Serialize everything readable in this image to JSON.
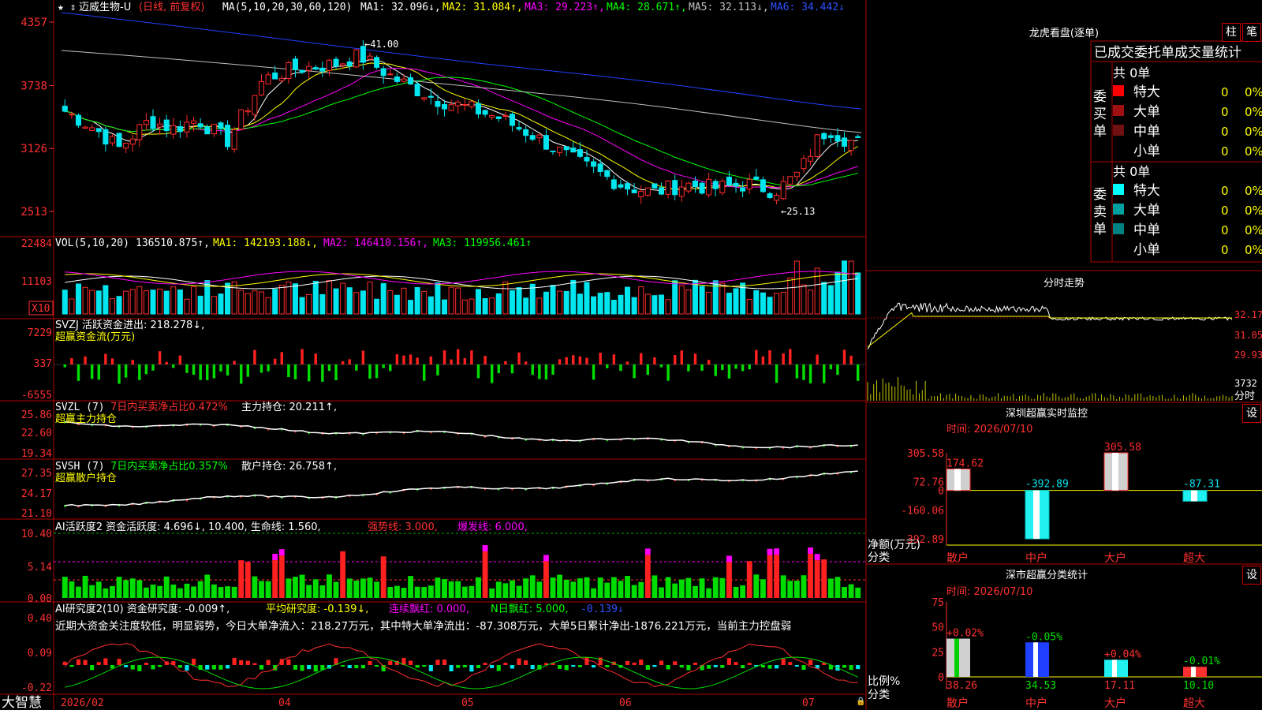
{
  "app": {
    "brand": "大智慧",
    "brand_color": "#ffffff"
  },
  "colors": {
    "up": "#ff2a2a",
    "down": "#00e5ee",
    "grid": "#a00000",
    "pos_bar": "#ff2020",
    "neg_bar": "#00dd00",
    "ma1": "#ffffff",
    "ma2": "#ffff00",
    "ma3": "#ff00ff",
    "ma4": "#00ff00",
    "ma5": "#c0c0c0",
    "ma6": "#2040ff"
  },
  "header": {
    "icons": "★ ⇕",
    "stock": "迈威生物-U",
    "mode": "(日线, 前复权)",
    "ma_def": "MA(5,10,20,30,60,120)",
    "ma1": "MA1: 32.096↓,",
    "ma2": "MA2: 31.084↑,",
    "ma3": "MA3: 29.223↑,",
    "ma4": "MA4: 28.671↑,",
    "ma5": "MA5: 32.113↓,",
    "ma6": "MA6: 34.442↓"
  },
  "price_axis": [
    "4357",
    "3738",
    "3126",
    "2513"
  ],
  "annotations": {
    "high": "←41.00",
    "low": "←25.13"
  },
  "vol": {
    "def": "VOL(5,10,20)",
    "value": "136510.875↑,",
    "ma1": "MA1: 142193.188↓,",
    "ma2": "MA2: 146410.156↑,",
    "ma3": "MA3: 119956.461↑",
    "axis": [
      "22484",
      "11103"
    ],
    "unit": "X10"
  },
  "svzj": {
    "title": "SVZJ  活跃资金进出: 218.278↓,",
    "sub": "超赢资金流(万元)",
    "axis": [
      "7229",
      "337",
      "-6555"
    ]
  },
  "svzl": {
    "title": "SVZL (7)",
    "ratio": "7日内买卖净占比0.472%",
    "hold": "主力持仓: 20.211↑,",
    "sub": "超赢主力持仓",
    "axis": [
      "25.86",
      "22.60",
      "19.34"
    ]
  },
  "svsh": {
    "title": "SVSH (7)",
    "ratio": "7日内买卖净占比0.357%",
    "hold": "散户持仓: 26.758↑,",
    "sub": "超赢散户持仓",
    "axis": [
      "27.35",
      "24.17",
      "21.10"
    ]
  },
  "ai1": {
    "title": "AI活跃度2 资金活跃度: 4.696↓, 10.400, 生命线: 1.560,",
    "strong": "强势线: 3.000,",
    "burst": "爆发线: 6.000,",
    "axis": [
      "10.40",
      "5.14",
      "0.00"
    ]
  },
  "ai2": {
    "title": "AI研究度2(10) 资金研究度: -0.009↑,",
    "avg": "平均研究度: -0.139↓,",
    "red": "连续飘红: 0.000,",
    "nred": "N日飘红: 5.000,",
    "last": "-0.139↓",
    "comment": "近期大资金关注度较低，明显弱势，今日大单净流入：218.27万元，其中特大单净流出：-87.308万元，大单5日累计净出-1876.221万元，当前主力控盘弱",
    "axis": [
      "0.40",
      "0.09",
      "-0.22"
    ]
  },
  "date_axis": [
    "2026/02",
    "04",
    "05",
    "06",
    "07"
  ],
  "lhb": {
    "title": "龙虎看盘(逐单)",
    "btn_column": "柱",
    "btn_stroke": "笔",
    "heading": "已成交委托单成交量统计",
    "buy_label": "委买单",
    "sell_label": "委卖单",
    "buy_total": "共 0单",
    "sell_total": "共 0单",
    "buy_rows": [
      {
        "name": "特大",
        "count": "0",
        "pct": "0%",
        "color": "#ff0000"
      },
      {
        "name": "大单",
        "count": "0",
        "pct": "0%",
        "color": "#a01010"
      },
      {
        "name": "中单",
        "count": "0",
        "pct": "0%",
        "color": "#701010"
      },
      {
        "name": "小单",
        "count": "0",
        "pct": "0%",
        "color": ""
      }
    ],
    "sell_rows": [
      {
        "name": "特大",
        "count": "0",
        "pct": "0%",
        "color": "#00ffff"
      },
      {
        "name": "大单",
        "count": "0",
        "pct": "0%",
        "color": "#00a0a0"
      },
      {
        "name": "中单",
        "count": "0",
        "pct": "0%",
        "color": "#008080"
      },
      {
        "name": "小单",
        "count": "0",
        "pct": "0%",
        "color": ""
      }
    ]
  },
  "minute": {
    "title": "分时走势",
    "axis": [
      "32.17",
      "31.05",
      "29.93"
    ],
    "vol": "3732",
    "vol_label": "分时"
  },
  "sz_monitor": {
    "title": "深圳超赢实时监控",
    "btn": "设",
    "time": "时间: 2026/07/10",
    "axis": [
      "305.58",
      "72.76",
      "0",
      "-160.06",
      "-392.89"
    ],
    "ylabel": "净额(万元)",
    "xlabel": "分类",
    "cats": [
      "散户",
      "中户",
      "大户",
      "超大"
    ],
    "labels": [
      "174.62",
      "-392.89",
      "305.58",
      "-87.31"
    ]
  },
  "sz_class": {
    "title": "深市超赢分类统计",
    "btn": "设",
    "time": "时间: 2026/07/10",
    "axis": [
      "75",
      "50",
      "25",
      "0"
    ],
    "ylabel": "比例%",
    "xlabel": "分类",
    "cats": [
      "散户",
      "中户",
      "大户",
      "超大"
    ],
    "changes": [
      "+0.02%",
      "-0.05%",
      "+0.04%",
      "-0.01%"
    ],
    "labels": [
      "38.26",
      "34.53",
      "17.11",
      "10.10"
    ]
  },
  "chart_data": [
    {
      "type": "bar",
      "title": "深圳超赢实时监控",
      "ylabel": "净额(万元)",
      "xlabel": "分类",
      "categories": [
        "散户",
        "中户",
        "大户",
        "超大"
      ],
      "values": [
        174.62,
        -392.89,
        305.58,
        -87.31
      ],
      "ylim": [
        -392.89,
        305.58
      ]
    },
    {
      "type": "bar",
      "title": "深市超赢分类统计",
      "ylabel": "比例%",
      "xlabel": "分类",
      "categories": [
        "散户",
        "中户",
        "大户",
        "超大"
      ],
      "values": [
        38.26,
        34.53,
        17.11,
        10.1
      ],
      "ylim": [
        0,
        75
      ]
    },
    {
      "type": "line",
      "x": [
        "2026/02",
        "04",
        "05",
        "06",
        "07"
      ],
      "y_ticks": [
        43.57,
        37.38,
        31.26,
        25.13
      ],
      "ylim": [
        25.13,
        43.57
      ],
      "annotations": [
        41.0,
        25.13
      ],
      "series": [
        {
          "name": "MA1",
          "values": [
            32.096
          ]
        },
        {
          "name": "MA2",
          "values": [
            31.084
          ]
        },
        {
          "name": "MA3",
          "values": [
            29.223
          ]
        },
        {
          "name": "MA4",
          "values": [
            28.671
          ]
        },
        {
          "name": "MA5",
          "values": [
            32.113
          ]
        },
        {
          "name": "MA6",
          "values": [
            34.442
          ]
        }
      ]
    }
  ]
}
